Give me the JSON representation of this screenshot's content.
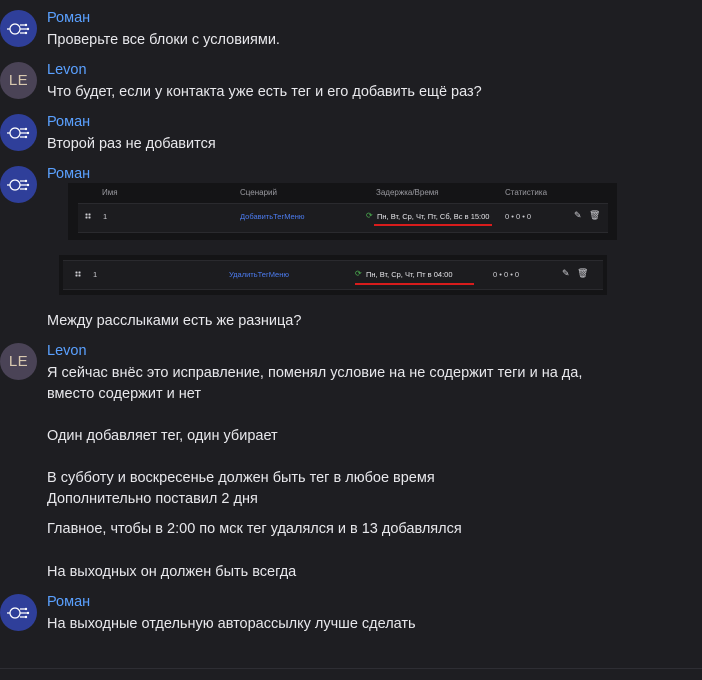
{
  "messages": [
    {
      "author": "Роман",
      "avatar": "bot",
      "lines": "Проверьте все блоки с условиями."
    },
    {
      "author": "Levon",
      "avatar": "LE",
      "lines": "Что будет, если у контакта уже есть тег и его добавить ещё раз?"
    },
    {
      "author": "Роман",
      "avatar": "bot",
      "lines": "Второй раз не добавится"
    },
    {
      "author": "Роман",
      "avatar": "bot"
    },
    {
      "author": "Levon",
      "avatar": "LE",
      "lines": "Я сейчас внёс это исправление, поменял условие на не содержит теги и на да,\nвместо содержит и нет\n\nОдин добавляет тег, один убирает\n\nВ субботу и воскресенье должен быть тег в любое время\nДополнительно поставил 2 дня"
    },
    {
      "author": "Роман",
      "avatar": "bot",
      "lines": "На выходные отдельную авторассылку лучше сделать"
    }
  ],
  "followups": {
    "between": "Между расслыками есть же разница?",
    "main": "Главное, чтобы в 2:00 по мск тег удалялся и в 13 добавлялся",
    "weekend": "На выходных он должен быть всегда"
  },
  "table": {
    "headers": {
      "name": "Имя",
      "scenario": "Сценарий",
      "delay": "Задержка/Время",
      "stats": "Статистика"
    },
    "row1": {
      "num": "1",
      "scenario": "ДобавитьТегМеню",
      "time": "Пн, Вт, Ср, Чт, Пт, Сб, Вс в 15:00",
      "stats": "0 • 0 • 0"
    },
    "row2": {
      "num": "1",
      "scenario": "УдалитьТегМеню",
      "time": "Пн, Вт, Ср, Чт, Пт в 04:00",
      "stats": "0 • 0 • 0"
    }
  },
  "colors": {
    "author": "#5aa0ff",
    "link": "#4c7cf0",
    "underline": "#d81c1c",
    "bg": "#1e1e22"
  }
}
